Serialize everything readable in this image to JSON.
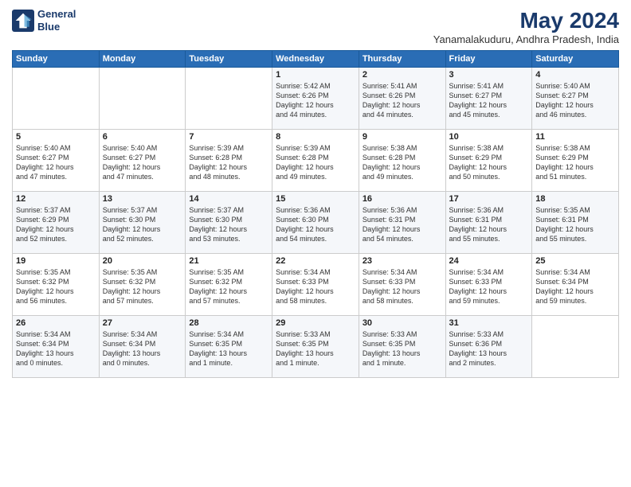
{
  "logo": {
    "line1": "General",
    "line2": "Blue"
  },
  "title": "May 2024",
  "location": "Yanamalakuduru, Andhra Pradesh, India",
  "weekdays": [
    "Sunday",
    "Monday",
    "Tuesday",
    "Wednesday",
    "Thursday",
    "Friday",
    "Saturday"
  ],
  "weeks": [
    [
      {
        "day": "",
        "info": ""
      },
      {
        "day": "",
        "info": ""
      },
      {
        "day": "",
        "info": ""
      },
      {
        "day": "1",
        "info": "Sunrise: 5:42 AM\nSunset: 6:26 PM\nDaylight: 12 hours\nand 44 minutes."
      },
      {
        "day": "2",
        "info": "Sunrise: 5:41 AM\nSunset: 6:26 PM\nDaylight: 12 hours\nand 44 minutes."
      },
      {
        "day": "3",
        "info": "Sunrise: 5:41 AM\nSunset: 6:27 PM\nDaylight: 12 hours\nand 45 minutes."
      },
      {
        "day": "4",
        "info": "Sunrise: 5:40 AM\nSunset: 6:27 PM\nDaylight: 12 hours\nand 46 minutes."
      }
    ],
    [
      {
        "day": "5",
        "info": "Sunrise: 5:40 AM\nSunset: 6:27 PM\nDaylight: 12 hours\nand 47 minutes."
      },
      {
        "day": "6",
        "info": "Sunrise: 5:40 AM\nSunset: 6:27 PM\nDaylight: 12 hours\nand 47 minutes."
      },
      {
        "day": "7",
        "info": "Sunrise: 5:39 AM\nSunset: 6:28 PM\nDaylight: 12 hours\nand 48 minutes."
      },
      {
        "day": "8",
        "info": "Sunrise: 5:39 AM\nSunset: 6:28 PM\nDaylight: 12 hours\nand 49 minutes."
      },
      {
        "day": "9",
        "info": "Sunrise: 5:38 AM\nSunset: 6:28 PM\nDaylight: 12 hours\nand 49 minutes."
      },
      {
        "day": "10",
        "info": "Sunrise: 5:38 AM\nSunset: 6:29 PM\nDaylight: 12 hours\nand 50 minutes."
      },
      {
        "day": "11",
        "info": "Sunrise: 5:38 AM\nSunset: 6:29 PM\nDaylight: 12 hours\nand 51 minutes."
      }
    ],
    [
      {
        "day": "12",
        "info": "Sunrise: 5:37 AM\nSunset: 6:29 PM\nDaylight: 12 hours\nand 52 minutes."
      },
      {
        "day": "13",
        "info": "Sunrise: 5:37 AM\nSunset: 6:30 PM\nDaylight: 12 hours\nand 52 minutes."
      },
      {
        "day": "14",
        "info": "Sunrise: 5:37 AM\nSunset: 6:30 PM\nDaylight: 12 hours\nand 53 minutes."
      },
      {
        "day": "15",
        "info": "Sunrise: 5:36 AM\nSunset: 6:30 PM\nDaylight: 12 hours\nand 54 minutes."
      },
      {
        "day": "16",
        "info": "Sunrise: 5:36 AM\nSunset: 6:31 PM\nDaylight: 12 hours\nand 54 minutes."
      },
      {
        "day": "17",
        "info": "Sunrise: 5:36 AM\nSunset: 6:31 PM\nDaylight: 12 hours\nand 55 minutes."
      },
      {
        "day": "18",
        "info": "Sunrise: 5:35 AM\nSunset: 6:31 PM\nDaylight: 12 hours\nand 55 minutes."
      }
    ],
    [
      {
        "day": "19",
        "info": "Sunrise: 5:35 AM\nSunset: 6:32 PM\nDaylight: 12 hours\nand 56 minutes."
      },
      {
        "day": "20",
        "info": "Sunrise: 5:35 AM\nSunset: 6:32 PM\nDaylight: 12 hours\nand 57 minutes."
      },
      {
        "day": "21",
        "info": "Sunrise: 5:35 AM\nSunset: 6:32 PM\nDaylight: 12 hours\nand 57 minutes."
      },
      {
        "day": "22",
        "info": "Sunrise: 5:34 AM\nSunset: 6:33 PM\nDaylight: 12 hours\nand 58 minutes."
      },
      {
        "day": "23",
        "info": "Sunrise: 5:34 AM\nSunset: 6:33 PM\nDaylight: 12 hours\nand 58 minutes."
      },
      {
        "day": "24",
        "info": "Sunrise: 5:34 AM\nSunset: 6:33 PM\nDaylight: 12 hours\nand 59 minutes."
      },
      {
        "day": "25",
        "info": "Sunrise: 5:34 AM\nSunset: 6:34 PM\nDaylight: 12 hours\nand 59 minutes."
      }
    ],
    [
      {
        "day": "26",
        "info": "Sunrise: 5:34 AM\nSunset: 6:34 PM\nDaylight: 13 hours\nand 0 minutes."
      },
      {
        "day": "27",
        "info": "Sunrise: 5:34 AM\nSunset: 6:34 PM\nDaylight: 13 hours\nand 0 minutes."
      },
      {
        "day": "28",
        "info": "Sunrise: 5:34 AM\nSunset: 6:35 PM\nDaylight: 13 hours\nand 1 minute."
      },
      {
        "day": "29",
        "info": "Sunrise: 5:33 AM\nSunset: 6:35 PM\nDaylight: 13 hours\nand 1 minute."
      },
      {
        "day": "30",
        "info": "Sunrise: 5:33 AM\nSunset: 6:35 PM\nDaylight: 13 hours\nand 1 minute."
      },
      {
        "day": "31",
        "info": "Sunrise: 5:33 AM\nSunset: 6:36 PM\nDaylight: 13 hours\nand 2 minutes."
      },
      {
        "day": "",
        "info": ""
      }
    ]
  ]
}
